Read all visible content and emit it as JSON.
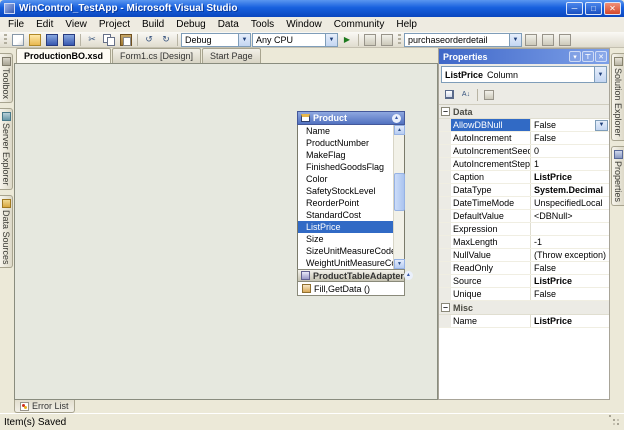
{
  "window": {
    "title": "WinControl_TestApp - Microsoft Visual Studio"
  },
  "icons": {
    "minimize": "─",
    "maximize": "□",
    "close": "✕",
    "dropdown": "▼",
    "chevron_up": "▴",
    "minus": "−",
    "play": "▶",
    "undo": "↺",
    "redo": "↻",
    "cut": "✂",
    "pin": "⊤",
    "menu_arrow": "▾",
    "sort_az": "A↓",
    "scroll_up": "▲",
    "scroll_down": "▼"
  },
  "menu": {
    "items": [
      "File",
      "Edit",
      "View",
      "Project",
      "Build",
      "Debug",
      "Data",
      "Tools",
      "Window",
      "Community",
      "Help"
    ]
  },
  "toolbar": {
    "debug_combo": "Debug",
    "platform_combo": "Any CPU",
    "find_combo": "purchaseorderdetail"
  },
  "doc_tabs": [
    {
      "label": "ProductionBO.xsd"
    },
    {
      "label": "Form1.cs [Design]"
    },
    {
      "label": "Start Page"
    }
  ],
  "left_tabs": [
    {
      "label": "Toolbox"
    },
    {
      "label": "Server Explorer"
    },
    {
      "label": "Data Sources"
    }
  ],
  "right_tabs": [
    {
      "label": "Solution Explorer"
    },
    {
      "label": "Properties"
    }
  ],
  "designer": {
    "product": {
      "title": "Product",
      "columns": [
        "Name",
        "ProductNumber",
        "MakeFlag",
        "FinishedGoodsFlag",
        "Color",
        "SafetyStockLevel",
        "ReorderPoint",
        "StandardCost",
        "ListPrice",
        "Size",
        "SizeUnitMeasureCode",
        "WeightUnitMeasureCode"
      ],
      "selected_column": "ListPrice"
    },
    "adapter": {
      "title": "ProductTableAdapter",
      "method": "Fill,GetData ()"
    }
  },
  "properties": {
    "panel_title": "Properties",
    "object_name": "ListPrice",
    "object_type": "Column",
    "groups": [
      {
        "name": "Data",
        "rows": [
          {
            "key": "AllowDBNull",
            "value": "False"
          },
          {
            "key": "AutoIncrement",
            "value": "False"
          },
          {
            "key": "AutoIncrementSeed",
            "value": "0"
          },
          {
            "key": "AutoIncrementStep",
            "value": "1"
          },
          {
            "key": "Caption",
            "value": "ListPrice"
          },
          {
            "key": "DataType",
            "value": "System.Decimal"
          },
          {
            "key": "DateTimeMode",
            "value": "UnspecifiedLocal"
          },
          {
            "key": "DefaultValue",
            "value": "<DBNull>"
          },
          {
            "key": "Expression",
            "value": ""
          },
          {
            "key": "MaxLength",
            "value": "-1"
          },
          {
            "key": "NullValue",
            "value": "(Throw exception)"
          },
          {
            "key": "ReadOnly",
            "value": "False"
          },
          {
            "key": "Source",
            "value": "ListPrice"
          },
          {
            "key": "Unique",
            "value": "False"
          }
        ]
      },
      {
        "name": "Misc",
        "rows": [
          {
            "key": "Name",
            "value": "ListPrice"
          }
        ]
      }
    ]
  },
  "error_list": {
    "label": "Error List"
  },
  "status_bar": {
    "text": "Item(s) Saved"
  },
  "colors": {
    "titlebar": "#1760DE",
    "selection": "#316AC5",
    "panel_header": "#3F67C8",
    "designer_bg": "#E6E8DF"
  }
}
